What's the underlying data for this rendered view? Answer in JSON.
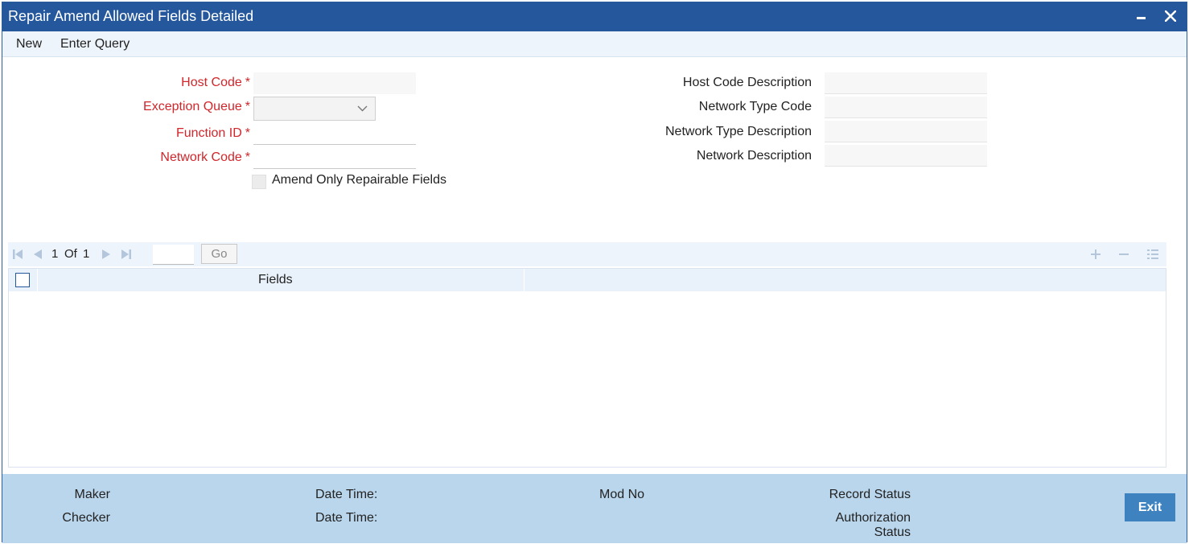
{
  "window": {
    "title": "Repair Amend Allowed Fields Detailed"
  },
  "menu": {
    "new_label": "New",
    "enter_query_label": "Enter Query"
  },
  "form": {
    "host_code": {
      "label": "Host Code",
      "value": ""
    },
    "exception_queue": {
      "label": "Exception Queue",
      "value": ""
    },
    "function_id": {
      "label": "Function ID",
      "value": ""
    },
    "network_code": {
      "label": "Network Code",
      "value": ""
    },
    "amend_only_repairable": {
      "label": "Amend Only Repairable Fields",
      "checked": false
    },
    "host_code_description": {
      "label": "Host Code Description",
      "value": ""
    },
    "network_type_code": {
      "label": "Network Type Code",
      "value": ""
    },
    "network_type_description": {
      "label": "Network Type Description",
      "value": ""
    },
    "network_description": {
      "label": "Network Description",
      "value": ""
    },
    "required_marker": "*"
  },
  "grid": {
    "pager": {
      "current": "1",
      "of_label": "Of",
      "total": "1",
      "go_label": "Go"
    },
    "columns": [
      "Fields"
    ],
    "rows": []
  },
  "footer": {
    "maker_label": "Maker",
    "checker_label": "Checker",
    "date_time_label_1": "Date Time:",
    "date_time_label_2": "Date Time:",
    "mod_no_label": "Mod No",
    "record_status_label": "Record Status",
    "authorization_label": "Authorization",
    "status_label": "Status",
    "exit_label": "Exit"
  },
  "colors": {
    "title_bar": "#24579b",
    "required_label": "#d0262b",
    "footer_bg": "#bad6ec",
    "exit_button": "#3e82c0"
  },
  "icons": [
    "minimize-icon",
    "close-icon",
    "chevron-down-icon",
    "first-page-icon",
    "prev-page-icon",
    "next-page-icon",
    "last-page-icon",
    "add-row-icon",
    "delete-row-icon",
    "list-view-icon"
  ]
}
